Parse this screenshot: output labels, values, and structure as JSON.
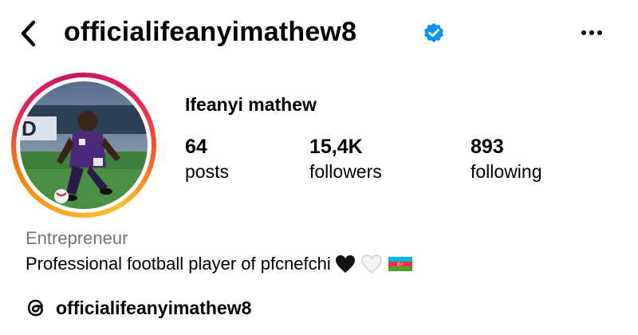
{
  "header": {
    "username": "officialifeanyimathew8",
    "verified": true,
    "back_icon": "chevron-left-icon",
    "more_icon": "more-horizontal-icon"
  },
  "profile": {
    "display_name": "Ifeanyi mathew",
    "stats": [
      {
        "value": "64",
        "label": "posts"
      },
      {
        "value": "15,4K",
        "label": "followers"
      },
      {
        "value": "893",
        "label": "following"
      }
    ],
    "category": "Entrepreneur",
    "bio": "Professional football player of pfcnefchi",
    "bio_emojis": [
      "black-heart",
      "white-heart",
      "azerbaijan-flag"
    ],
    "threads_handle": "officialifeanyimathew8"
  },
  "colors": {
    "verified_blue": "#0095f6",
    "category_gray": "#737373",
    "ring_orange": "#f9a825",
    "ring_pink": "#e91e63"
  }
}
